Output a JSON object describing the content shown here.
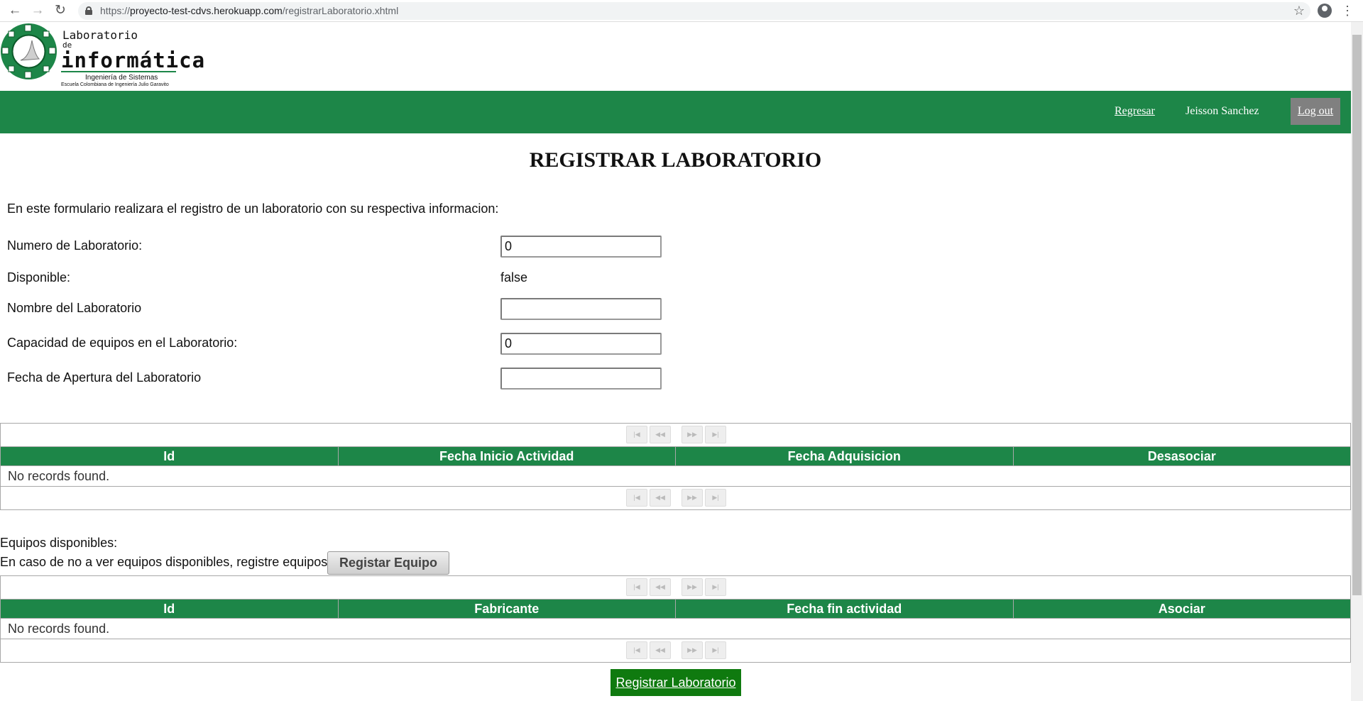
{
  "browser": {
    "url_prefix": "https://",
    "url_host": "proyecto-test-cdvs.herokuapp.com",
    "url_path": "/registrarLaboratorio.xhtml"
  },
  "logo": {
    "line1": "Laboratorio",
    "line2": "de",
    "line3": "informática",
    "sub1": "Ingeniería de Sistemas",
    "sub2": "Escuela Colombiana de Ingeniería Julio Garavito"
  },
  "header": {
    "back_link": "Regresar",
    "user_name": "Jeisson Sanchez",
    "logout": "Log out"
  },
  "page": {
    "title": "REGISTRAR LABORATORIO",
    "intro": "En este formulario realizara el registro de un laboratorio con su respectiva informacion:"
  },
  "form": {
    "numero_label": "Numero de Laboratorio:",
    "numero_value": "0",
    "disponible_label": "Disponible:",
    "disponible_value": "false",
    "nombre_label": "Nombre del Laboratorio",
    "nombre_value": "",
    "capacidad_label": "Capacidad de equipos en el Laboratorio:",
    "capacidad_value": "0",
    "fecha_label": "Fecha de Apertura del Laboratorio",
    "fecha_value": ""
  },
  "paginator": {
    "first": "|◀",
    "prev": "◀◀",
    "next": "▶▶",
    "last": "▶|"
  },
  "table1": {
    "headers": [
      "Id",
      "Fecha Inicio Actividad",
      "Fecha Adquisicion",
      "Desasociar"
    ],
    "empty": "No records found."
  },
  "equipos": {
    "label": "Equipos disponibles:",
    "hint": "En caso de no a ver equipos disponibles, registre equipos:",
    "button": "Registar Equipo"
  },
  "table2": {
    "headers": [
      "Id",
      "Fabricante",
      "Fecha fin actividad",
      "Asociar"
    ],
    "empty": "No records found."
  },
  "submit": {
    "label": "Registrar Laboratorio"
  }
}
